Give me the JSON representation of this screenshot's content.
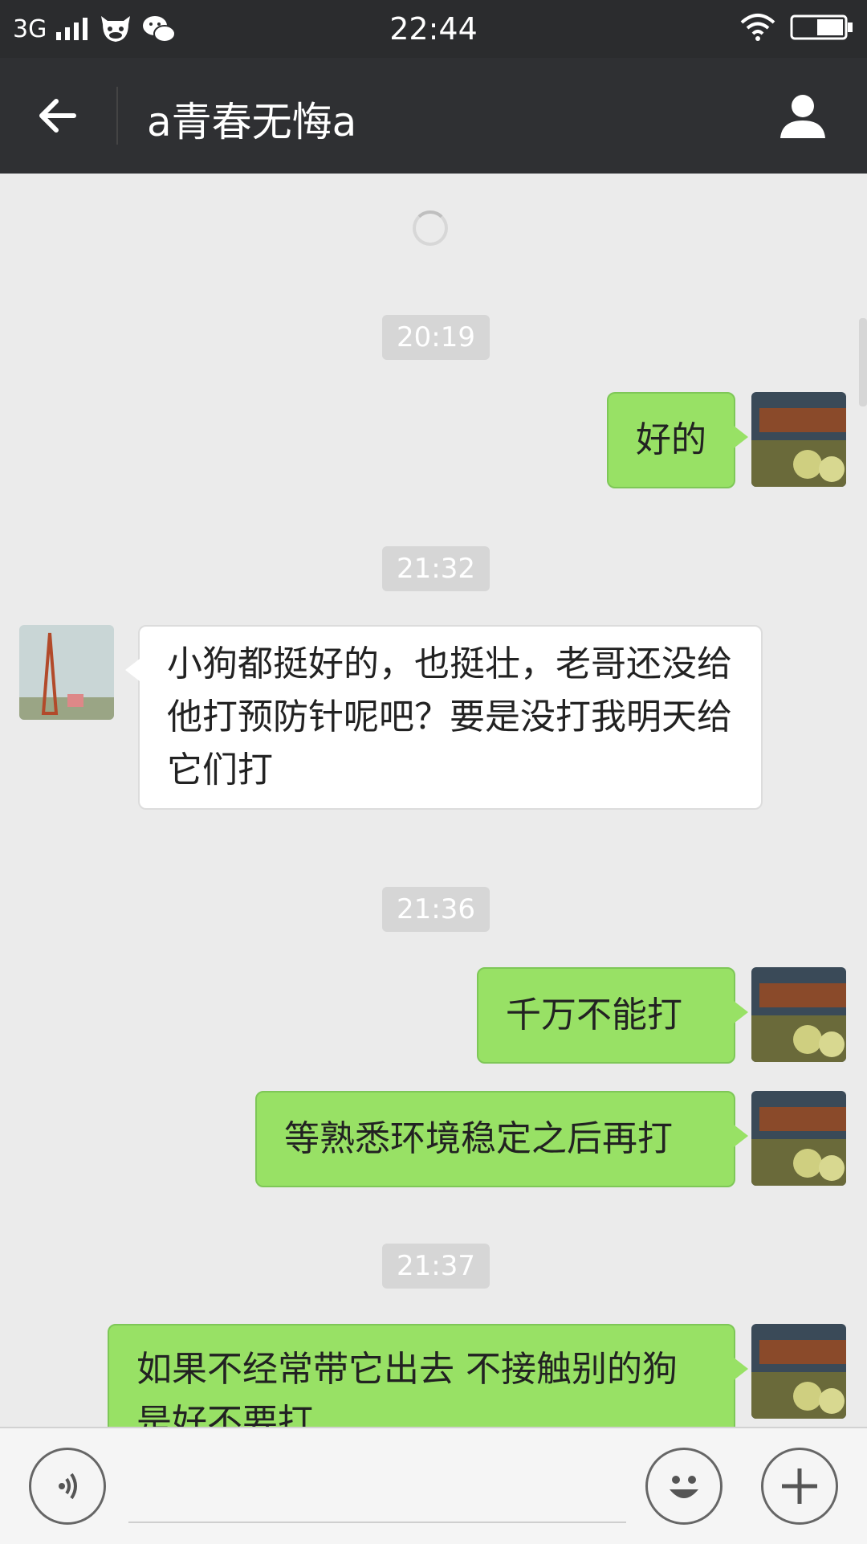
{
  "status_bar": {
    "network": "3G",
    "time": "22:44"
  },
  "header": {
    "title": "a青春无悔a"
  },
  "messages": [
    {
      "type": "timestamp",
      "text": "20:19"
    },
    {
      "type": "sent",
      "text": "好的"
    },
    {
      "type": "timestamp",
      "text": "21:32"
    },
    {
      "type": "received",
      "text": "小狗都挺好的，也挺壮，老哥还没给他打预防针呢吧？要是没打我明天给它们打"
    },
    {
      "type": "timestamp",
      "text": "21:36"
    },
    {
      "type": "sent",
      "text": "千万不能打"
    },
    {
      "type": "sent",
      "text": "等熟悉环境稳定之后再打"
    },
    {
      "type": "timestamp",
      "text": "21:37"
    },
    {
      "type": "sent",
      "text": "如果不经常带它出去   不接触别的狗是好不要打"
    }
  ],
  "colors": {
    "sent_bubble": "#98e165",
    "received_bubble": "#ffffff",
    "header_bg": "#2f3033",
    "chat_bg": "#ebebeb"
  },
  "icons": [
    "back-arrow-icon",
    "person-icon",
    "voice-icon",
    "emoji-icon",
    "plus-icon",
    "signal-icon",
    "wifi-icon",
    "battery-icon"
  ]
}
